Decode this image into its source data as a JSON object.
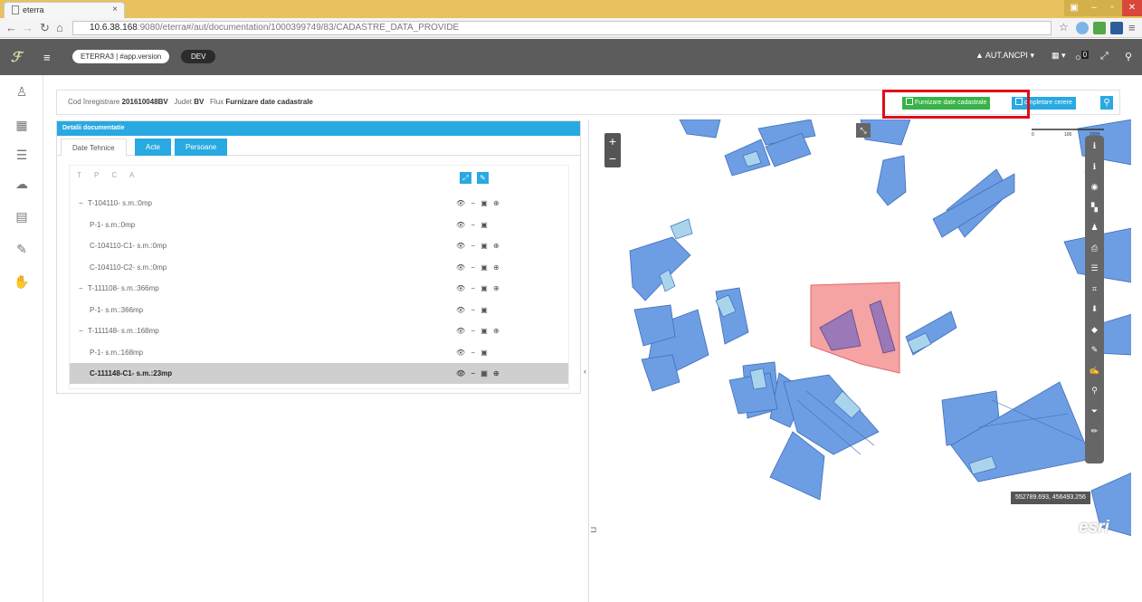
{
  "browser": {
    "tab_title": "eterra",
    "tab_close": "×",
    "url_host": "10.6.38.168",
    "url_rest": ":9080/eterra#/aut/documentation/1000399749/83/CADASTRE_DATA_PROVIDE"
  },
  "header": {
    "app_name": "ETERRA3 | #app.version",
    "env": "DEV",
    "user": "AUT.ANCPI",
    "notif_count": "0"
  },
  "info": {
    "cod_label": "Cod înregistrare",
    "cod_value": "201610048BV",
    "judet_label": "Judet",
    "judet_value": "BV",
    "flux_label": "Flux",
    "flux_value": "Furnizare date cadastrale"
  },
  "actions": {
    "furnizare_label": "Furnizare date cadastrale",
    "completare_label": "ompletare cerere"
  },
  "panel": {
    "title": "Detalii documentatie",
    "tabs": [
      "Date Tehnice",
      "Acte",
      "Persoane"
    ],
    "tree_header": "T P C A",
    "rows": [
      {
        "label": "T-104110- s.m.:0mp",
        "prefix": "−",
        "child": false,
        "acts": "👁 − ▣ ⊕"
      },
      {
        "label": "P-1- s.m.:0mp",
        "prefix": "",
        "child": true,
        "acts": "👁 − ▣"
      },
      {
        "label": "C-104110-C1- s.m.:0mp",
        "prefix": "",
        "child": true,
        "acts": "👁 − ▣ ⊕"
      },
      {
        "label": "C-104110-C2- s.m.:0mp",
        "prefix": "",
        "child": true,
        "acts": "👁 − ▣ ⊕"
      },
      {
        "label": "T-111108- s.m.:366mp",
        "prefix": "−",
        "child": false,
        "acts": "👁 − ▣ ⊕"
      },
      {
        "label": "P-1- s.m.:366mp",
        "prefix": "",
        "child": true,
        "acts": "👁 − ▣"
      },
      {
        "label": "T-111148- s.m.:168mp",
        "prefix": "−",
        "child": false,
        "acts": "👁 − ▣ ⊕"
      },
      {
        "label": "P-1- s.m.:168mp",
        "prefix": "",
        "child": true,
        "acts": "👁 − ▣"
      },
      {
        "label": "C-111148-C1- s.m.:23mp",
        "prefix": "",
        "child": true,
        "acts": "👁 − ▣ ⊕",
        "selected": true
      }
    ]
  },
  "map": {
    "coords": "552789.693, 456493.256",
    "scale_labels": [
      "0",
      "100",
      "200ft"
    ],
    "logo": "esri",
    "zoom_in": "+",
    "zoom_out": "−",
    "tools": [
      "ℹ-icon",
      "info-icon",
      "location-icon",
      "layers-icon",
      "person-icon",
      "print-icon",
      "list-icon",
      "crop-icon",
      "download-icon",
      "tag-icon",
      "pencil-icon",
      "edit-icon",
      "search-icon",
      "filter-icon",
      "draw-icon"
    ]
  },
  "colors": {
    "accent": "#29a9e1",
    "green": "#38b349",
    "parcel": "#6d9de3",
    "parcel_light": "#a9d4ec",
    "selected_parcel": "#f5a3a3",
    "highlight": "#e30b17"
  }
}
